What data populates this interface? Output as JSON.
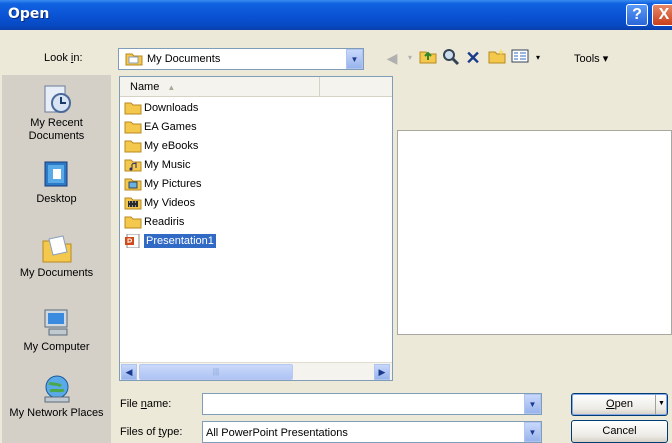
{
  "window": {
    "title": "Open",
    "help_glyph": "?",
    "close_glyph": "X"
  },
  "look_in": {
    "label_pre": "Look ",
    "label_hot": "i",
    "label_post": "n:",
    "value": "My Documents"
  },
  "toolbar": {
    "tools_label": "Tools"
  },
  "places": [
    {
      "label": "My Recent Documents",
      "icon": "recent-documents-icon"
    },
    {
      "label": "Desktop",
      "icon": "desktop-icon"
    },
    {
      "label": "My Documents",
      "icon": "my-documents-icon"
    },
    {
      "label": "My Computer",
      "icon": "my-computer-icon"
    },
    {
      "label": "My Network Places",
      "icon": "network-places-icon"
    }
  ],
  "file_list": {
    "column_header": "Name",
    "items": [
      {
        "name": "Downloads",
        "type": "folder",
        "selected": false
      },
      {
        "name": "EA Games",
        "type": "folder",
        "selected": false
      },
      {
        "name": "My eBooks",
        "type": "folder",
        "selected": false
      },
      {
        "name": "My Music",
        "type": "music-folder",
        "selected": false
      },
      {
        "name": "My Pictures",
        "type": "pictures-folder",
        "selected": false
      },
      {
        "name": "My Videos",
        "type": "videos-folder",
        "selected": false
      },
      {
        "name": "Readiris",
        "type": "folder",
        "selected": false
      },
      {
        "name": "Presentation1",
        "type": "powerpoint-file",
        "selected": true
      }
    ]
  },
  "file_name": {
    "label_pre": "File ",
    "label_hot": "n",
    "label_post": "ame:",
    "value": ""
  },
  "file_type": {
    "label_pre": "Files of ",
    "label_hot": "t",
    "label_post": "ype:",
    "value": "All PowerPoint Presentations"
  },
  "buttons": {
    "open_pre": "",
    "open_hot": "O",
    "open_post": "pen",
    "cancel": "Cancel"
  },
  "colors": {
    "title_bar": "#0a52d4",
    "selection": "#316ac5",
    "dialog_bg": "#ece9d8",
    "folder_yellow": "#f4c84c"
  }
}
